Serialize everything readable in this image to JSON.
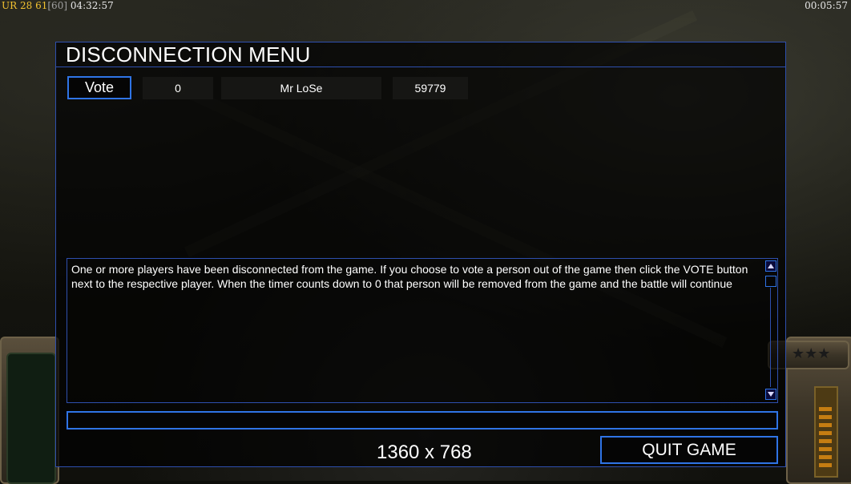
{
  "overlay": {
    "top_left_prefix": "UR",
    "top_left_a": "28",
    "top_left_b": "61",
    "top_left_c": "[60]",
    "top_left_time": "04:32:57",
    "top_right_time": "00:05:57"
  },
  "menu": {
    "title": "DISCONNECTION MENU",
    "players": [
      {
        "vote_label": "Vote",
        "votes": "0",
        "name": "Mr LoSe",
        "timer": "59779"
      }
    ],
    "message": "One or more players have been disconnected from the game. If you choose to vote a person out of the game then click the VOTE button next to the respective player. When the timer counts down to 0 that person will be removed from the game and the battle will continue",
    "chat_value": "",
    "resolution": "1360 x 768",
    "quit_label": "QUIT GAME"
  },
  "colors": {
    "accent": "#2f74e6",
    "frame": "#2e4fae",
    "overlay_yellow": "#f2c230",
    "power": "#c57d12"
  },
  "icons": {
    "scroll_up": "up-arrow",
    "scroll_down": "down-arrow",
    "rank": "star-icon"
  }
}
